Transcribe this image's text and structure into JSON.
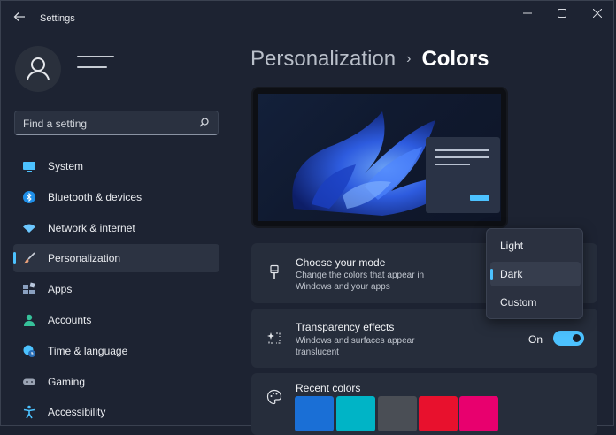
{
  "window": {
    "title": "Settings",
    "back_icon": "back-arrow-icon",
    "controls": [
      "minimize-icon",
      "maximize-icon",
      "close-icon"
    ]
  },
  "sidebar": {
    "search": {
      "placeholder": "Find a setting",
      "icon": "search-icon"
    },
    "items": [
      {
        "label": "System",
        "icon": "monitor-icon",
        "color": "#4cc2ff"
      },
      {
        "label": "Bluetooth & devices",
        "icon": "bluetooth-icon",
        "color": "#1f8fe8"
      },
      {
        "label": "Network & internet",
        "icon": "wifi-icon",
        "color": "#6cc7ff"
      },
      {
        "label": "Personalization",
        "icon": "brush-icon",
        "color": "#e8a07a",
        "active": true
      },
      {
        "label": "Apps",
        "icon": "apps-icon",
        "color": "#8aa0c0"
      },
      {
        "label": "Accounts",
        "icon": "person-icon",
        "color": "#36c19a"
      },
      {
        "label": "Time & language",
        "icon": "globe-clock-icon",
        "color": "#4cc2ff"
      },
      {
        "label": "Gaming",
        "icon": "gamepad-icon",
        "color": "#9aa3b3"
      },
      {
        "label": "Accessibility",
        "icon": "accessibility-icon",
        "color": "#4cc2ff"
      }
    ]
  },
  "breadcrumb": {
    "parent": "Personalization",
    "separator": "›",
    "current": "Colors"
  },
  "mode_card": {
    "title": "Choose your mode",
    "subtitle": "Change the colors that appear in Windows and your apps",
    "icon": "brush-handle-icon"
  },
  "transparency_card": {
    "title": "Transparency effects",
    "subtitle": "Windows and surfaces appear translucent",
    "toggle_label": "On",
    "toggle_on": true,
    "icon": "sparkle-frame-icon"
  },
  "recent_colors_card": {
    "title": "Recent colors",
    "icon": "palette-icon",
    "swatches": [
      "#1a6fd6",
      "#00b4c6",
      "#4a4e55",
      "#e8112d",
      "#e8006e"
    ]
  },
  "mode_dropdown": {
    "options": [
      "Light",
      "Dark",
      "Custom"
    ],
    "selected": "Dark"
  },
  "colors": {
    "accent": "#4cc2ff"
  }
}
